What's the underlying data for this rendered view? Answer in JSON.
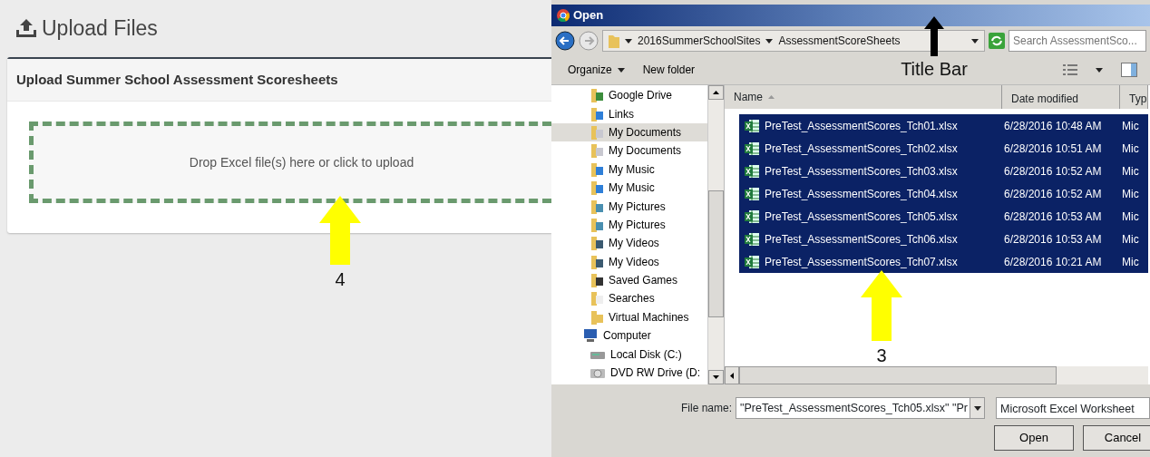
{
  "page": {
    "title": "Upload Files",
    "card_title": "Upload Summer School Assessment Scoresheets",
    "dropzone_text": "Drop Excel file(s) here or click to upload"
  },
  "dialog": {
    "title": "Open",
    "breadcrumb": [
      "2016SummerSchoolSites",
      "AssessmentScoreSheets"
    ],
    "search": {
      "placeholder": "Search AssessmentSco..."
    },
    "toolbar": [
      "Organize",
      "New folder"
    ],
    "nav_items": [
      {
        "label": "Google Drive",
        "kind": "drive",
        "selected": false
      },
      {
        "label": "Links",
        "kind": "links",
        "selected": false
      },
      {
        "label": "My Documents",
        "kind": "docs",
        "selected": true
      },
      {
        "label": "My Documents",
        "kind": "docs",
        "selected": false
      },
      {
        "label": "My Music",
        "kind": "music",
        "selected": false
      },
      {
        "label": "My Music",
        "kind": "music",
        "selected": false
      },
      {
        "label": "My Pictures",
        "kind": "pictures",
        "selected": false
      },
      {
        "label": "My Pictures",
        "kind": "pictures",
        "selected": false
      },
      {
        "label": "My Videos",
        "kind": "videos",
        "selected": false
      },
      {
        "label": "My Videos",
        "kind": "videos",
        "selected": false
      },
      {
        "label": "Saved Games",
        "kind": "games",
        "selected": false
      },
      {
        "label": "Searches",
        "kind": "search",
        "selected": false
      },
      {
        "label": "Virtual Machines",
        "kind": "folder",
        "selected": false
      },
      {
        "label": "Computer",
        "kind": "computer",
        "selected": false,
        "children": [
          {
            "label": "Local Disk (C:)",
            "kind": "disk",
            "selected": false
          },
          {
            "label": "DVD RW Drive (D:",
            "kind": "dvd",
            "selected": false
          }
        ]
      }
    ],
    "columns": [
      "Name",
      "Date modified",
      "Typ"
    ],
    "files": [
      {
        "name": "PreTest_AssessmentScores_Tch01.xlsx",
        "date": "6/28/2016 10:48 AM",
        "type": "Mic",
        "selected": true
      },
      {
        "name": "PreTest_AssessmentScores_Tch02.xlsx",
        "date": "6/28/2016 10:51 AM",
        "type": "Mic",
        "selected": true
      },
      {
        "name": "PreTest_AssessmentScores_Tch03.xlsx",
        "date": "6/28/2016 10:52 AM",
        "type": "Mic",
        "selected": true
      },
      {
        "name": "PreTest_AssessmentScores_Tch04.xlsx",
        "date": "6/28/2016 10:52 AM",
        "type": "Mic",
        "selected": true
      },
      {
        "name": "PreTest_AssessmentScores_Tch05.xlsx",
        "date": "6/28/2016 10:53 AM",
        "type": "Mic",
        "selected": true
      },
      {
        "name": "PreTest_AssessmentScores_Tch06.xlsx",
        "date": "6/28/2016 10:53 AM",
        "type": "Mic",
        "selected": true
      },
      {
        "name": "PreTest_AssessmentScores_Tch07.xlsx",
        "date": "6/28/2016 10:21 AM",
        "type": "Mic",
        "selected": true
      }
    ],
    "file_name_label": "File name:",
    "file_name_value": "\"PreTest_AssessmentScores_Tch05.xlsx\" \"Pr",
    "file_type": "Microsoft Excel Worksheet",
    "buttons": [
      "Open",
      "Cancel"
    ]
  },
  "annotations": [
    {
      "label": "Title Bar",
      "color": "#000000"
    },
    {
      "label": "4",
      "color": "#ffff00"
    },
    {
      "label": "3",
      "color": "#ffff00"
    }
  ]
}
